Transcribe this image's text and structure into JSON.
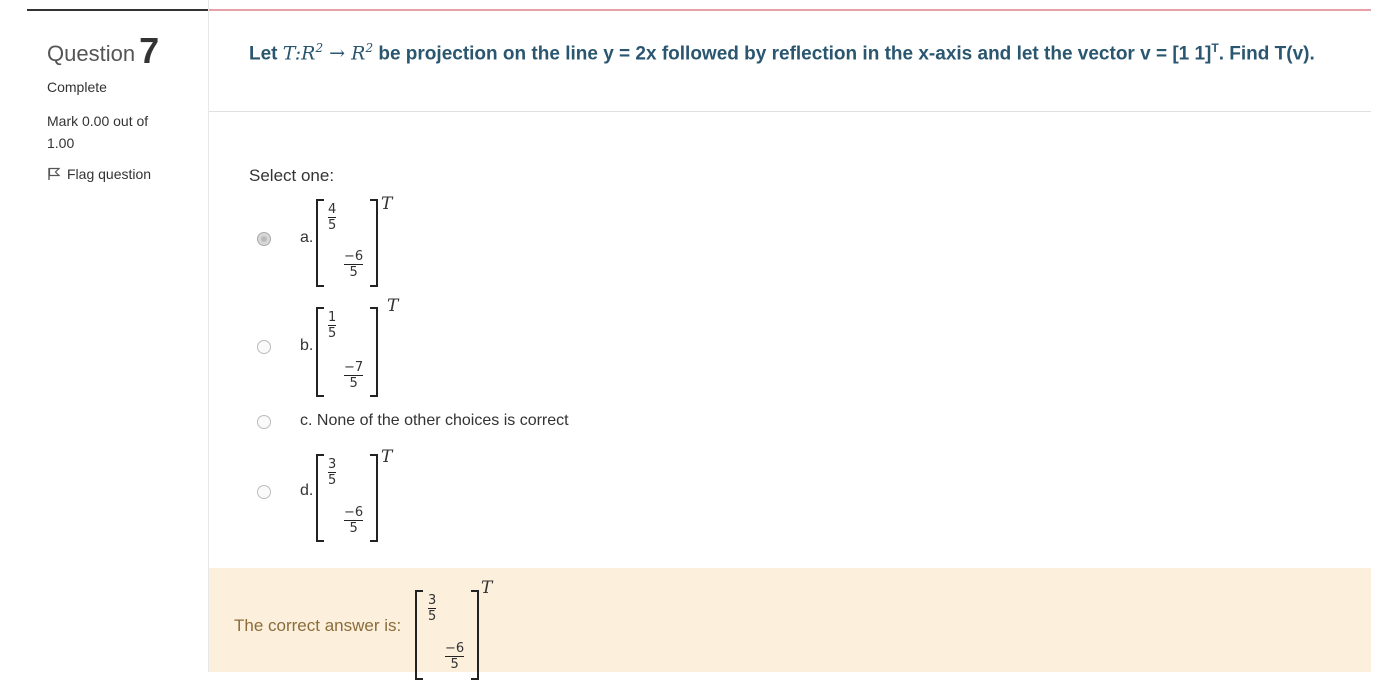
{
  "question": {
    "label": "Question",
    "number": "7",
    "state": "Complete",
    "grade": "Mark 0.00 out of 1.00",
    "flag_label": "Flag question"
  },
  "qtext": {
    "prefix": "Let",
    "math_map": "T:R",
    "sup1": "2",
    "arrow": " → ",
    "math_r": "R",
    "sup2": "2",
    "body": " be projection on the line y = 2x followed by reflection in the x-axis and let the vector v = [1  1]",
    "sup_t": "T",
    "suffix": ". Find T(v)."
  },
  "prompt": "Select one:",
  "options": [
    {
      "letter": "a.",
      "top_num": "4",
      "top_den": "5",
      "bot_num": "−6",
      "bot_den": "5",
      "selected": true
    },
    {
      "letter": "b.",
      "top_num": "1",
      "top_den": "5",
      "bot_num": "−7",
      "bot_den": "5",
      "selected": false
    },
    {
      "letter": "c.",
      "text": "None of the other choices is correct",
      "selected": false
    },
    {
      "letter": "d.",
      "top_num": "3",
      "top_den": "5",
      "bot_num": "−6",
      "bot_den": "5",
      "selected": false
    }
  ],
  "transpose": "T",
  "feedback": {
    "label": "The correct answer is:",
    "top_num": "3",
    "top_den": "5",
    "bot_num": "−6",
    "bot_den": "5"
  }
}
